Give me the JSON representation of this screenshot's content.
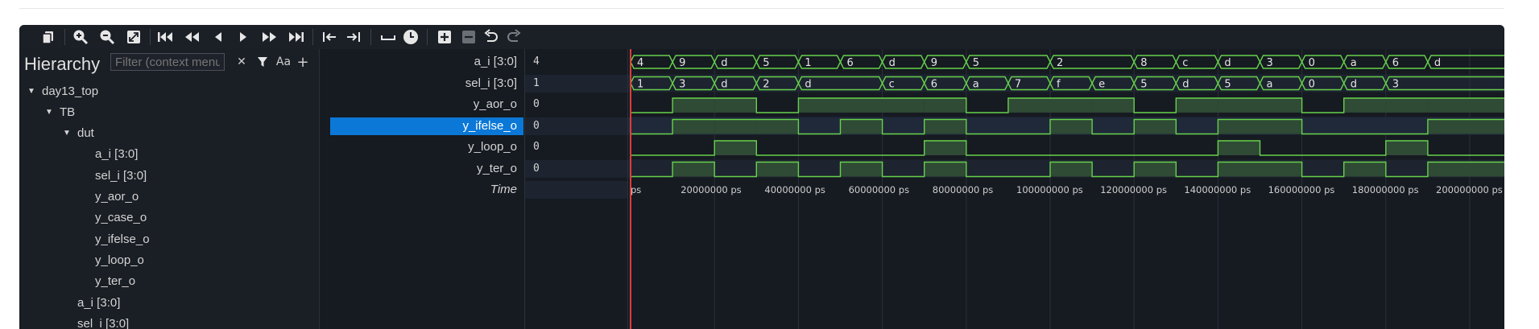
{
  "colors": {
    "wave": "#66d14b",
    "wave_fill": "#2f4a35",
    "cursor": "#e03c3c",
    "selection": "#0b78d7"
  },
  "toolbar": {
    "icons": [
      "copy-icon",
      "zoom-in-icon",
      "zoom-out-icon",
      "zoom-fit-icon",
      "go-to-start-icon",
      "previous-page-icon",
      "step-back-icon",
      "step-forward-icon",
      "next-page-icon",
      "go-to-end-icon",
      "previous-transition-icon",
      "next-transition-icon",
      "add-divider-icon",
      "add-timestamp-icon",
      "add-icon",
      "remove-icon",
      "undo-icon",
      "redo-icon"
    ]
  },
  "hierarchy": {
    "title": "Hierarchy",
    "filter_placeholder": "Filter (context menu",
    "clear_symbol": "✕",
    "filter_icon": "funnel-icon",
    "case_symbol": "Aa",
    "add_symbol": "+",
    "tree": [
      {
        "label": "day13_top",
        "expanded": true,
        "depth": 0
      },
      {
        "label": "TB",
        "expanded": true,
        "depth": 1
      },
      {
        "label": "dut",
        "expanded": true,
        "depth": 2
      },
      {
        "label": "a_i [3:0]",
        "depth": 3
      },
      {
        "label": "sel_i [3:0]",
        "depth": 3
      },
      {
        "label": "y_aor_o",
        "depth": 3
      },
      {
        "label": "y_case_o",
        "depth": 3
      },
      {
        "label": "y_ifelse_o",
        "depth": 3
      },
      {
        "label": "y_loop_o",
        "depth": 3
      },
      {
        "label": "y_ter_o",
        "depth": 3
      },
      {
        "label": "a_i [3:0]",
        "depth": 2
      },
      {
        "label": "sel_i [3:0]",
        "depth": 2
      }
    ]
  },
  "signals": [
    {
      "name": "a_i [3:0]",
      "value": "4"
    },
    {
      "name": "sel_i [3:0]",
      "value": "1"
    },
    {
      "name": "y_aor_o",
      "value": "0"
    },
    {
      "name": "y_ifelse_o",
      "value": "0",
      "selected": true
    },
    {
      "name": "y_loop_o",
      "value": "0"
    },
    {
      "name": "y_ter_o",
      "value": "0"
    }
  ],
  "time_label": "Time",
  "waves": {
    "unit_ps": 10000000,
    "cursor_ps": 0,
    "buses": [
      {
        "name": "a_i [3:0]",
        "values": [
          "4",
          "9",
          "d",
          "5",
          "1",
          "6",
          "d",
          "9",
          "5",
          "5",
          "2",
          "2",
          "8",
          "c",
          "d",
          "3",
          "0",
          "a",
          "6",
          "d",
          "d"
        ]
      },
      {
        "name": "sel_i [3:0]",
        "values": [
          "1",
          "3",
          "d",
          "2",
          "d",
          "d",
          "c",
          "6",
          "a",
          "7",
          "f",
          "e",
          "5",
          "d",
          "5",
          "a",
          "0",
          "d",
          "3",
          "3",
          "3"
        ]
      }
    ],
    "bits": [
      {
        "name": "y_aor_o",
        "values": [
          0,
          1,
          1,
          0,
          1,
          1,
          1,
          1,
          0,
          1,
          1,
          1,
          0,
          1,
          1,
          1,
          0,
          1,
          1,
          1,
          1
        ]
      },
      {
        "name": "y_ifelse_o",
        "values": [
          0,
          1,
          1,
          1,
          0,
          1,
          0,
          1,
          0,
          0,
          1,
          0,
          1,
          0,
          1,
          1,
          0,
          0,
          0,
          1,
          1
        ]
      },
      {
        "name": "y_loop_o",
        "values": [
          0,
          0,
          1,
          0,
          0,
          0,
          0,
          1,
          0,
          0,
          0,
          0,
          0,
          0,
          1,
          0,
          0,
          0,
          1,
          0,
          0
        ]
      },
      {
        "name": "y_ter_o",
        "values": [
          0,
          1,
          0,
          1,
          0,
          1,
          0,
          1,
          0,
          0,
          1,
          0,
          1,
          0,
          1,
          1,
          0,
          1,
          0,
          1,
          1
        ]
      }
    ],
    "ticks": [
      "ps",
      "20000000 ps",
      "40000000 ps",
      "60000000 ps",
      "80000000 ps",
      "100000000 ps",
      "120000000 ps",
      "140000000 ps",
      "160000000 ps",
      "180000000 ps",
      "200000000 ps"
    ]
  }
}
